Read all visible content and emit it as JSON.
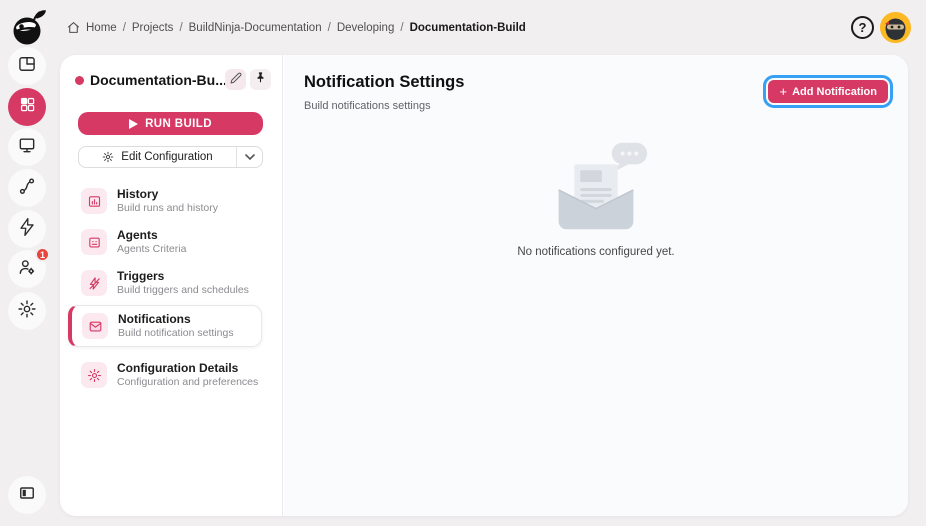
{
  "breadcrumb": {
    "items": [
      "Home",
      "Projects",
      "BuildNinja-Documentation",
      "Developing",
      "Documentation-Build"
    ],
    "separator": "/"
  },
  "header": {
    "help_label": "?"
  },
  "user": {
    "badge_count": "1"
  },
  "sidebar": {
    "title": "Documentation-Bu...",
    "run_build": "RUN BUILD",
    "edit_configuration": "Edit Configuration",
    "menu": [
      {
        "label": "History",
        "desc": "Build runs and history"
      },
      {
        "label": "Agents",
        "desc": "Agents Criteria"
      },
      {
        "label": "Triggers",
        "desc": "Build triggers and schedules"
      },
      {
        "label": "Notifications",
        "desc": "Build notification settings"
      },
      {
        "label": "Configuration Details",
        "desc": "Configuration and preferences"
      }
    ]
  },
  "main": {
    "title": "Notification Settings",
    "subtitle": "Build notifications settings",
    "add_notification": {
      "plus": "+",
      "label": "Add Notification"
    },
    "empty_text": "No notifications configured yet."
  },
  "colors": {
    "primary_pink": "#d63964",
    "primary_pink_light": "#fbe9ef",
    "highlight_blue": "#36a0f4",
    "avatar_yellow": "#fdb924",
    "badge_red": "#e8453c"
  }
}
